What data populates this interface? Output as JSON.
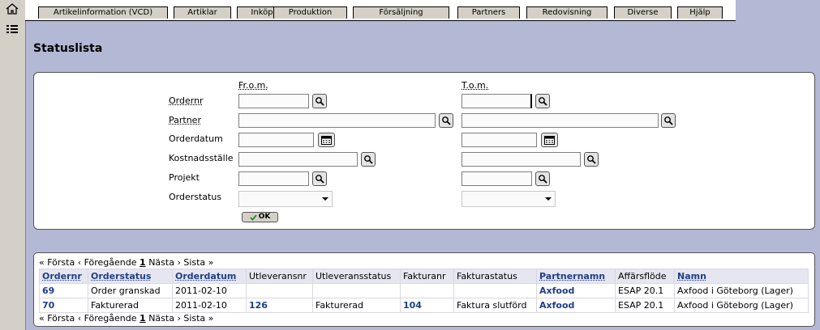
{
  "tabs": [
    {
      "key": "artikelinformation",
      "label": "Artikelinformation (VCD)"
    },
    {
      "key": "artiklar",
      "label": "Artiklar"
    },
    {
      "key": "inkop",
      "label": "Inköp"
    },
    {
      "key": "produktion",
      "label": "Produktion"
    },
    {
      "key": "forsaljning",
      "label": "Försäljning"
    },
    {
      "key": "partners",
      "label": "Partners"
    },
    {
      "key": "redovisning",
      "label": "Redovisning"
    },
    {
      "key": "diverse",
      "label": "Diverse"
    },
    {
      "key": "hjalp",
      "label": "Hjälp"
    }
  ],
  "page": {
    "title": "Statuslista"
  },
  "search": {
    "from_label": "Fr.o.m.",
    "to_label": "T.o.m.",
    "fields": {
      "ordernr": {
        "label": "Ordernr",
        "from": "",
        "to": ""
      },
      "partner": {
        "label": "Partner",
        "from": "",
        "to": ""
      },
      "orderdatum": {
        "label": "Orderdatum",
        "from": "",
        "to": ""
      },
      "kostnadsstalle": {
        "label": "Kostnadsställe",
        "from": "",
        "to": ""
      },
      "projekt": {
        "label": "Projekt",
        "from": "",
        "to": ""
      },
      "orderstatus": {
        "label": "Orderstatus",
        "from": "",
        "to": ""
      }
    },
    "ok_label": "OK"
  },
  "pager": {
    "first": "« Första",
    "prev": "‹ Föregående",
    "current": "1",
    "next": "Nästa ›",
    "last": "Sista »"
  },
  "results": {
    "columns": [
      "Ordernr",
      "Orderstatus",
      "Orderdatum",
      "Utleveransnr",
      "Utleveransstatus",
      "Fakturanr",
      "Fakturastatus",
      "Partnernamn",
      "Affärsflöde",
      "Namn"
    ],
    "rows": [
      [
        "69",
        "Order granskad",
        "2011-02-10",
        "",
        "",
        "",
        "",
        "Axfood",
        "ESAP 20.1",
        "Axfood i Göteborg (Lager)"
      ],
      [
        "70",
        "Fakturerad",
        "2011-02-10",
        "126",
        "Fakturerad",
        "104",
        "Faktura slutförd",
        "Axfood",
        "ESAP 20.1",
        "Axfood i Göteborg (Lager)"
      ]
    ]
  },
  "colors": {
    "background": "#b3b8d4",
    "link": "#1f3d8a",
    "header_bg": "#e6e6f0"
  },
  "icons": {
    "home": "home-icon",
    "list": "list-icon",
    "search": "magnifier-icon",
    "calendar": "calendar-icon",
    "ok": "checkmark-icon"
  }
}
